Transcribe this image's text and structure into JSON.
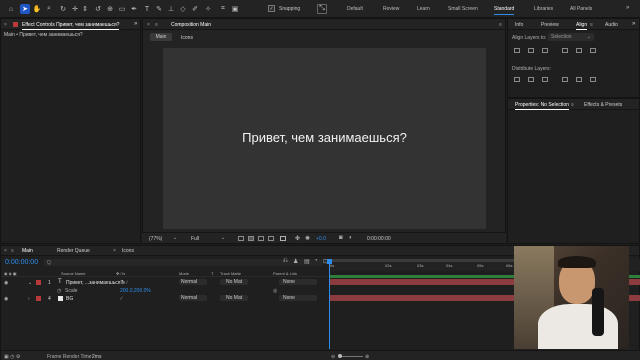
{
  "toolbar": {
    "snapping_label": "Snapping",
    "workspaces": [
      "Default",
      "Review",
      "Learn",
      "Small Screen",
      "Standard",
      "Libraries",
      "All Panels"
    ],
    "active_workspace": "Standard"
  },
  "effect_controls": {
    "tab_label": "Effect Controls Привет, чем занимаешься?",
    "subtitle": "Main • Привет, чем занимаешься?",
    "more": "»"
  },
  "composition": {
    "tab_label": "Composition Main",
    "breadcrumbs": [
      "Main",
      "Icons"
    ],
    "text": "Привет, чем занимаешься?",
    "zoom": "(77%)",
    "resolution": "Full",
    "exposure": "+0.0",
    "timecode": "0:00:00:00"
  },
  "right_panel": {
    "tabs": [
      "Info",
      "Preview",
      "Align",
      "Audio"
    ],
    "active_tab": "Align",
    "align_layers_to_label": "Align Layers to:",
    "align_layers_to_value": "Selection",
    "distribute_label": "Distribute Layers:",
    "properties_tab": "Properties: No Selection",
    "effects_tab": "Effects & Presets"
  },
  "timeline": {
    "tabs": [
      "Main",
      "Render Queue",
      "Icons"
    ],
    "timecode": "0:00:00:00",
    "search_placeholder": "Q",
    "columns": {
      "source": "Source Name",
      "mode": "Mode",
      "t": "T",
      "trackmatte": "Track Matte",
      "parent": "Parent & Link"
    },
    "layers": [
      {
        "num": "1",
        "name": "Привет, ...занимаешься?",
        "mode": "Normal",
        "trackmatte": "No Mat",
        "parent": "None",
        "color": "#b73a3a"
      },
      {
        "num": "4",
        "name": "BG",
        "mode": "Normal",
        "trackmatte": "No Mat",
        "parent": "None",
        "color": "#b73a3a"
      }
    ],
    "scale_label": "Scale",
    "scale_value": "200.0,200.0%",
    "ruler": [
      "0s",
      "02s",
      "03s",
      "04s",
      "05s",
      "06s"
    ],
    "footer_label": "Frame Render Time:",
    "footer_value": "2ms"
  },
  "colors": {
    "accent": "#2d8ceb",
    "layer_bar": "#8c3b3f",
    "layer_label": "#b73a3a"
  }
}
